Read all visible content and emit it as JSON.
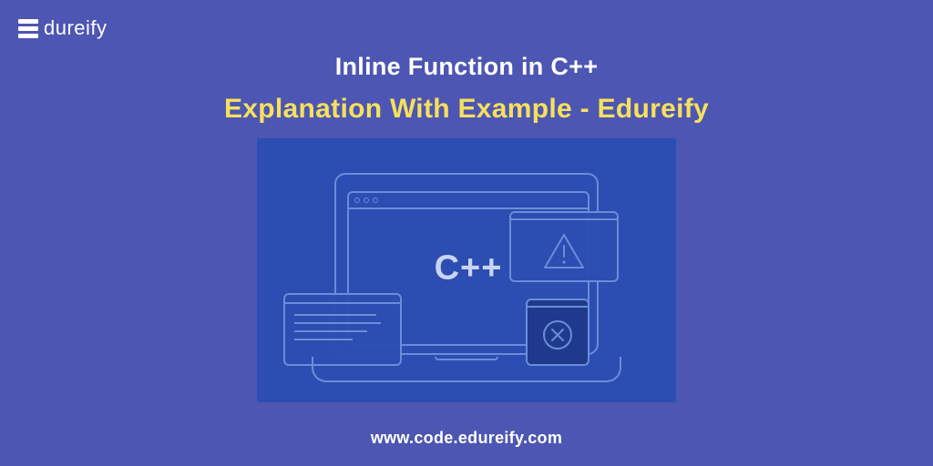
{
  "brand": {
    "name": "dureify"
  },
  "headline": {
    "line1": "Inline Function in C++",
    "line2": "Explanation With  Example - Edureify"
  },
  "illustration": {
    "screen_text": "C++"
  },
  "footer": {
    "url": "www.code.edureify.com"
  }
}
